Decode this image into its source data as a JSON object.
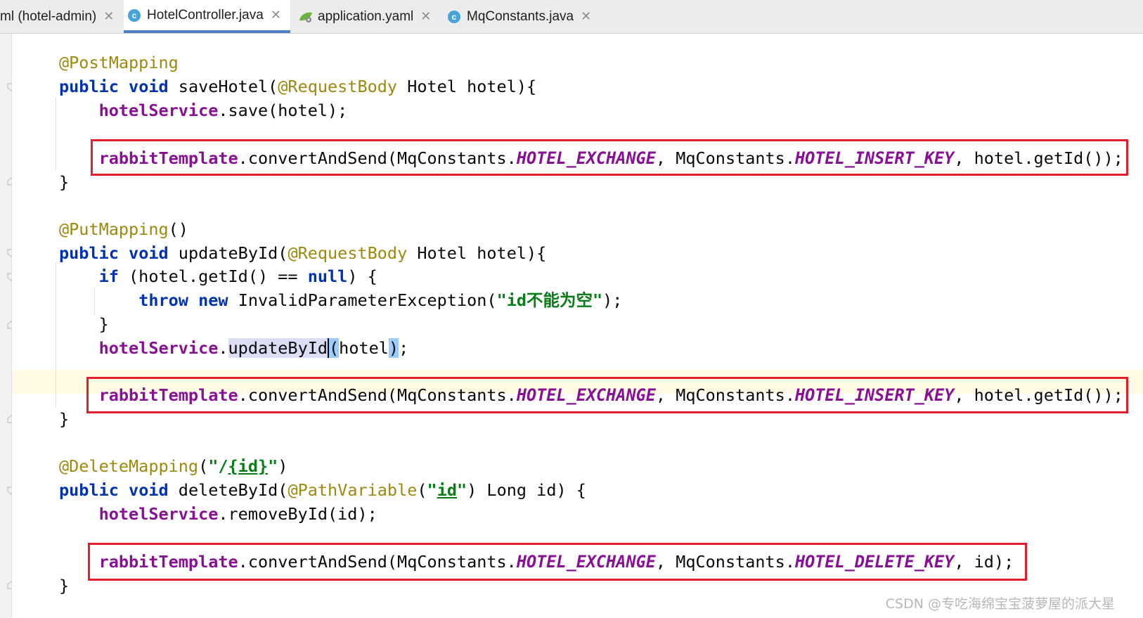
{
  "tabs": [
    {
      "label": "ml (hotel-admin)",
      "icon": "none",
      "active": false
    },
    {
      "label": "HotelController.java",
      "icon": "class-icon",
      "active": true
    },
    {
      "label": "application.yaml",
      "icon": "spring-yaml-icon",
      "active": false
    },
    {
      "label": "MqConstants.java",
      "icon": "class-icon",
      "active": false
    }
  ],
  "class_icon_glyph": "c",
  "close_glyph": "✕",
  "code": {
    "l1": {
      "a": "@PostMapping"
    },
    "l2": {
      "kw1": "public",
      "kw2": "void",
      "name": "saveHotel(",
      "ann": "@RequestBody",
      "rest": " Hotel hotel){"
    },
    "l3": {
      "field": "hotelService",
      "rest": ".save(hotel);"
    },
    "l4": {
      "field": "rabbitTemplate",
      "m": ".convertAndSend(MqConstants.",
      "c1": "HOTEL_EXCHANGE",
      "mid": ", MqConstants.",
      "c2": "HOTEL_INSERT_KEY",
      "rest": ", hotel.getId());"
    },
    "l5": {
      "t": "}"
    },
    "l6": {
      "a": "@PutMapping",
      "rest": "()"
    },
    "l7": {
      "kw1": "public",
      "kw2": "void",
      "name": "updateById(",
      "ann": "@RequestBody",
      "rest": " Hotel hotel){"
    },
    "l8": {
      "kw1": "if",
      "mid": " (hotel.getId() == ",
      "kw2": "null",
      "rest": ") {"
    },
    "l9": {
      "kw1": "throw",
      "kw2": "new",
      "mid": " InvalidParameterException(",
      "str": "\"id不能为空\"",
      "rest": ");"
    },
    "l10": {
      "t": "}"
    },
    "l11": {
      "field": "hotelService",
      "dot": ".",
      "hl": "updateById",
      "p1": "(",
      "arg": "hotel",
      "p2": ")",
      "rest": ";"
    },
    "l12": {
      "field": "rabbitTemplate",
      "m": ".convertAndSend(MqConstants.",
      "c1": "HOTEL_EXCHANGE",
      "mid": ", MqConstants.",
      "c2": "HOTEL_INSERT_KEY",
      "rest": ", hotel.getId());"
    },
    "l13": {
      "t": "}"
    },
    "l14": {
      "a": "@DeleteMapping",
      "p": "(",
      "s1": "\"/",
      "s2": "{id}",
      "s3": "\"",
      "rest": ")"
    },
    "l15": {
      "kw1": "public",
      "kw2": "void",
      "name": "deleteById(",
      "ann": "@PathVariable",
      "p": "(",
      "s1": "\"",
      "s2": "id",
      "s3": "\"",
      "rest": ") Long id) {"
    },
    "l16": {
      "field": "hotelService",
      "rest": ".removeById(id);"
    },
    "l17": {
      "field": "rabbitTemplate",
      "m": ".convertAndSend(MqConstants.",
      "c1": "HOTEL_EXCHANGE",
      "mid": ", MqConstants.",
      "c2": "HOTEL_DELETE_KEY",
      "rest": ", id);"
    },
    "l18": {
      "t": "}"
    }
  },
  "watermark": "CSDN @专吃海绵宝宝菠萝屋的派大星"
}
